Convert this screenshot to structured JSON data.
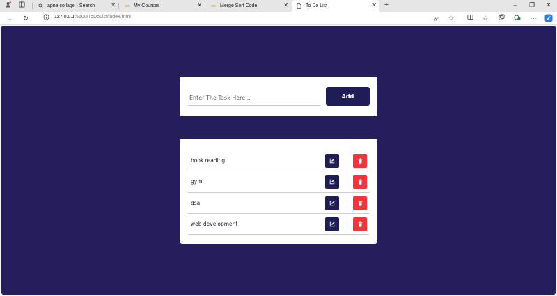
{
  "browser": {
    "tabs": [
      {
        "title": "apna collage - Search",
        "icon": "search-icon",
        "active": false
      },
      {
        "title": "My Courses",
        "icon": "dash-icon",
        "active": false
      },
      {
        "title": "Merge Sort Code",
        "icon": "dash-icon",
        "active": false
      },
      {
        "title": "To Do List",
        "icon": "page-icon",
        "active": true
      }
    ],
    "url_host": "127.0.0.1",
    "url_path": ":5500/ToDoList/index.html"
  },
  "app": {
    "input_placeholder": "Enter The Task Here...",
    "add_label": "Add",
    "tasks": [
      {
        "text": "book reading"
      },
      {
        "text": "gym"
      },
      {
        "text": "dsa"
      },
      {
        "text": "web development"
      }
    ]
  },
  "colors": {
    "background": "#261e5c",
    "primary": "#1f1d55",
    "danger": "#f0353b"
  }
}
